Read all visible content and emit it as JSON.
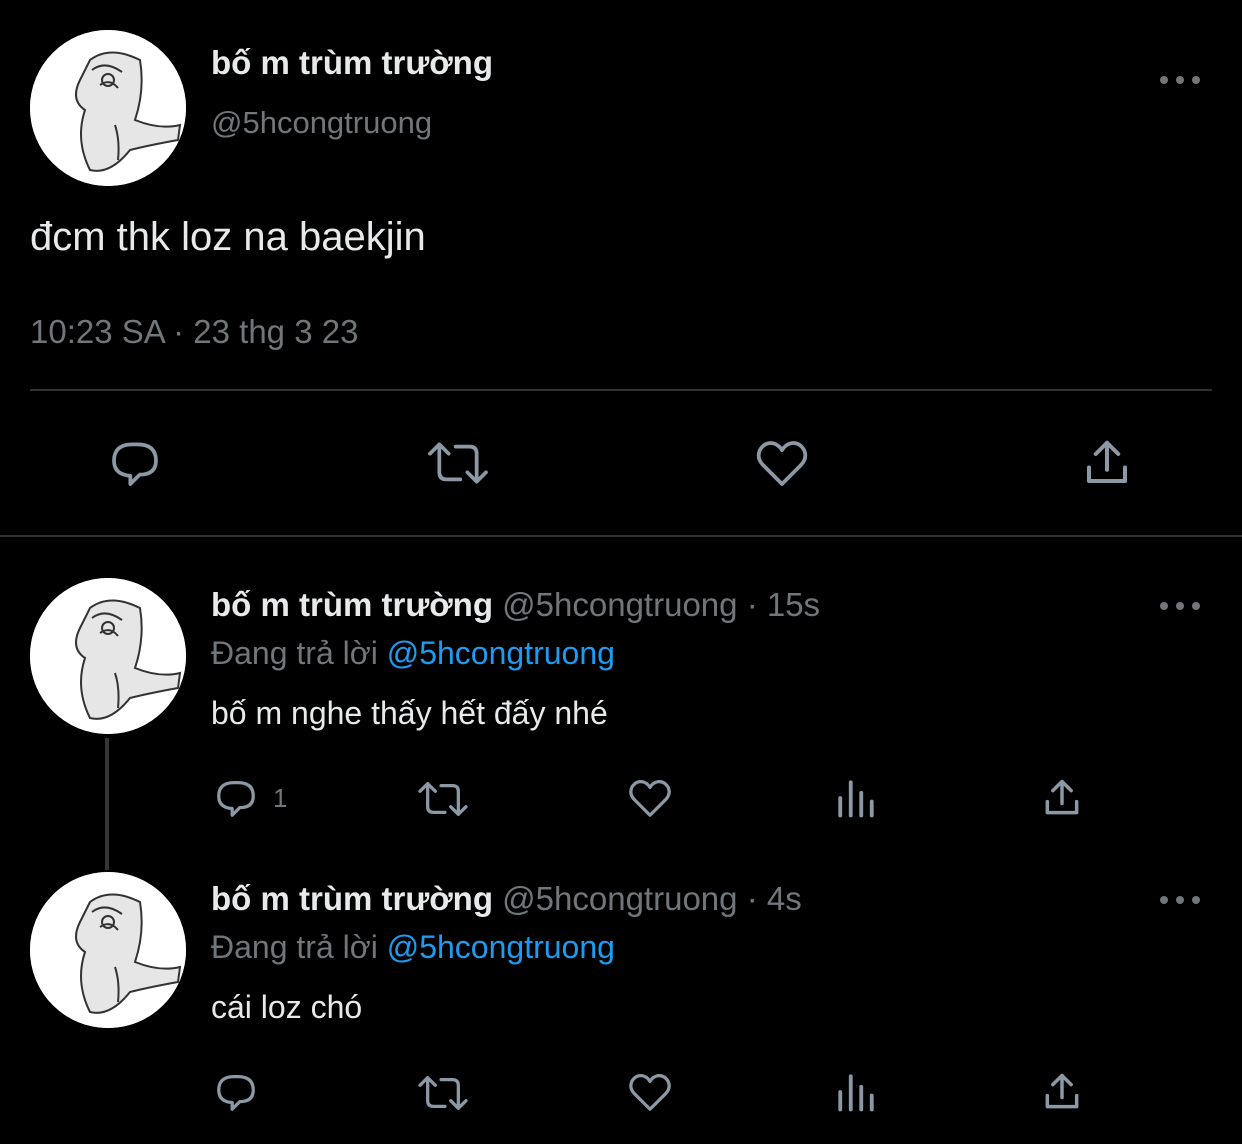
{
  "main_tweet": {
    "display_name": "bố m trùm trường",
    "handle": "@5hcongtruong",
    "text": "đcm thk loz na baekjin",
    "timestamp": "10:23 SA · 23 thg 3 23",
    "actions": [
      "reply-icon",
      "retweet-icon",
      "like-icon",
      "share-icon"
    ]
  },
  "replies": [
    {
      "display_name": "bố m trùm trường",
      "handle": "@5hcongtruong",
      "time": "· 15s",
      "replying_prefix": "Đang trả lời",
      "replying_to": "@5hcongtruong",
      "text": "bố m nghe thấy hết đấy nhé",
      "reply_count": "1"
    },
    {
      "display_name": "bố m trùm trường",
      "handle": "@5hcongtruong",
      "time": "· 4s",
      "replying_prefix": "Đang trả lời",
      "replying_to": "@5hcongtruong",
      "text": "cái loz chó",
      "reply_count": ""
    }
  ],
  "colors": {
    "background": "#000000",
    "text": "#e7e9ea",
    "muted": "#71767b",
    "accent": "#1d9bf0",
    "divider": "#2f3336"
  }
}
